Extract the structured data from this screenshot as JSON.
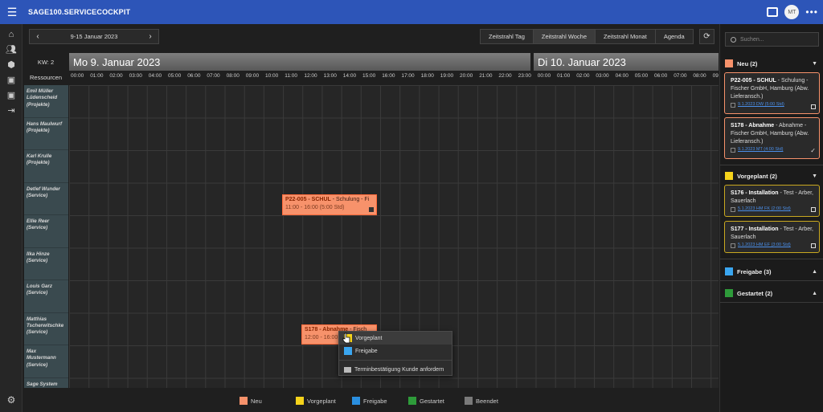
{
  "app": {
    "title": "SAGE100.SERVICECOCKPIT",
    "avatar_initials": "MT"
  },
  "leftnav": {
    "items": [
      "home-icon",
      "users-icon",
      "box-icon",
      "doc-1-icon",
      "doc-2-icon",
      "exit-icon"
    ],
    "settings": "gear-icon"
  },
  "toolbar": {
    "date_range": "9-15 Januar 2023",
    "prev": "‹",
    "next": "›",
    "views": [
      {
        "label": "Zeitstrahl Tag",
        "active": false
      },
      {
        "label": "Zeitstrahl Woche",
        "active": true
      },
      {
        "label": "Zeitstrahl Monat",
        "active": false
      },
      {
        "label": "Agenda",
        "active": false
      }
    ],
    "refresh": "⟳"
  },
  "grid": {
    "kw": "KW: 2",
    "resources_label": "Ressourcen",
    "days": [
      "Mo 9. Januar 2023",
      "Di 10. Januar 2023"
    ],
    "hours": [
      "00:00",
      "01:00",
      "02:00",
      "03:00",
      "04:00",
      "05:00",
      "06:00",
      "07:00",
      "08:00",
      "09:00",
      "10:00",
      "11:00",
      "12:00",
      "13:00",
      "14:00",
      "15:00",
      "16:00",
      "17:00",
      "18:00",
      "19:00",
      "20:00",
      "21:00",
      "22:00",
      "23:00",
      "00:00",
      "01:00",
      "02:00",
      "03:00",
      "04:00",
      "05:00",
      "06:00",
      "07:00",
      "08:00",
      "09:00"
    ],
    "resources": [
      {
        "line1": "Emil Müller",
        "line2": "Lüdenscheid",
        "line3": "(Projekte)"
      },
      {
        "line1": "Hans Maulwurf",
        "line2": "(Projekte)",
        "line3": ""
      },
      {
        "line1": "Karl Krulle",
        "line2": "(Projekte)",
        "line3": ""
      },
      {
        "line1": "Detlef Wunder",
        "line2": "(Service)",
        "line3": ""
      },
      {
        "line1": "Ellie Reer",
        "line2": "(Service)",
        "line3": ""
      },
      {
        "line1": "Ilka Hinze",
        "line2": "(Service)",
        "line3": ""
      },
      {
        "line1": "Louis Garz",
        "line2": "(Service)",
        "line3": ""
      },
      {
        "line1": "Matthias",
        "line2": "Tscherwitschke",
        "line3": "(Service)"
      },
      {
        "line1": "Max",
        "line2": "Mustermann",
        "line3": "(Service)"
      },
      {
        "line1": "Sage System",
        "line2": "Administrator",
        "line3": ""
      }
    ],
    "events": [
      {
        "title": "P22-005 - SCHUL",
        "desc": " - Schulung - Fi",
        "time": "11:00 - 16:00 (5:00 Std)"
      },
      {
        "title": "S178 - Abnahme",
        "desc": " - Fisch",
        "time": "12:00 - 16:00"
      }
    ]
  },
  "context_menu": {
    "items": [
      {
        "label": "Vorgeplant",
        "color": "#f5d31b"
      },
      {
        "label": "Freigabe",
        "color": "#3aa6f0"
      }
    ],
    "mail_item": "Terminbestätigung Kunde anfordern"
  },
  "legend": [
    {
      "label": "Neu",
      "color": "#f7926b"
    },
    {
      "label": "Vorgeplant",
      "color": "#f5d31b"
    },
    {
      "label": "Freigabe",
      "color": "#2a8fe0"
    },
    {
      "label": "Gestartet",
      "color": "#2e9b3a"
    },
    {
      "label": "Beendet",
      "color": "#7a7a7a"
    }
  ],
  "rpanel": {
    "search_placeholder": "Suchen...",
    "groups": [
      {
        "label": "Neu (2)",
        "color": "#f7926b",
        "caret": "▼"
      },
      {
        "label": "Vorgeplant (2)",
        "color": "#f5d31b",
        "caret": "▼"
      },
      {
        "label": "Freigabe (3)",
        "color": "#3aa6f0",
        "caret": "▲"
      },
      {
        "label": "Gestartet (2)",
        "color": "#2e9b3a",
        "caret": "▲"
      }
    ],
    "cards": [
      {
        "title": "P22-005 - SCHUL",
        "desc": " - Schulung - Fischer GmbH, Hamburg (Abw. Lieferansch.)",
        "link": "9.1.2023 DW (5:00 Std)",
        "border": "#f7926b"
      },
      {
        "title": "S178 - Abnahme",
        "desc": " - Abnahme - Fischer GmbH, Hamburg (Abw. Lieferansch.)",
        "link": "9.1.2023 MT (4:00 Std)",
        "border": "#f7926b"
      },
      {
        "title": "S176 - Installation",
        "desc": " - Test - Arber, Sauerlach",
        "link": "5.1.2023 HM FK (2:00 Std)",
        "border": "#c9a820"
      },
      {
        "title": "S177 - Installation",
        "desc": " - Test - Arber, Sauerlach",
        "link": "5.1.2023 HM EF (3:00 Std)",
        "border": "#c9a820"
      }
    ]
  }
}
